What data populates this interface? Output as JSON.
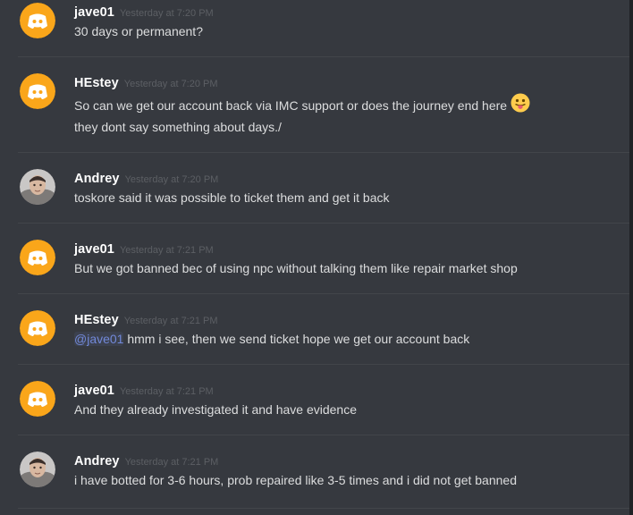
{
  "colors": {
    "background": "#36393f",
    "username": "#ffffff",
    "timestamp": "#5c5f64",
    "message_text": "#dcddde",
    "mention": "#7289da",
    "discord_avatar_bg": "#faa61a",
    "divider": "#42454a"
  },
  "messages": [
    {
      "username": "jave01",
      "timestamp": "Yesterday at 7:20 PM",
      "avatar": "discord-default-avatar",
      "lines": [
        "30 days or permanent?"
      ]
    },
    {
      "username": "HEstey",
      "timestamp": "Yesterday at 7:20 PM",
      "avatar": "discord-default-avatar",
      "lines": [
        "So can we get our account back via IMC support or does the journey end here",
        "they dont say something about days./"
      ],
      "emoji": "face-with-tongue-emoji"
    },
    {
      "username": "Andrey",
      "timestamp": "Yesterday at 7:20 PM",
      "avatar": "user-photo-avatar",
      "lines": [
        "toskore said it was possible to ticket them and get it back"
      ]
    },
    {
      "username": "jave01",
      "timestamp": "Yesterday at 7:21 PM",
      "avatar": "discord-default-avatar",
      "lines": [
        "But we got banned bec of using npc without talking them like repair market shop"
      ]
    },
    {
      "username": "HEstey",
      "timestamp": "Yesterday at 7:21 PM",
      "avatar": "discord-default-avatar",
      "mention": "@jave01",
      "lines": [
        "hmm i see, then we send ticket hope we get our account back"
      ]
    },
    {
      "username": "jave01",
      "timestamp": "Yesterday at 7:21 PM",
      "avatar": "discord-default-avatar",
      "lines": [
        "And they already investigated it and have evidence"
      ]
    },
    {
      "username": "Andrey",
      "timestamp": "Yesterday at 7:21 PM",
      "avatar": "user-photo-avatar",
      "lines": [
        "i have botted for 3-6 hours, prob repaired like 3-5 times and i did not get banned"
      ]
    }
  ]
}
